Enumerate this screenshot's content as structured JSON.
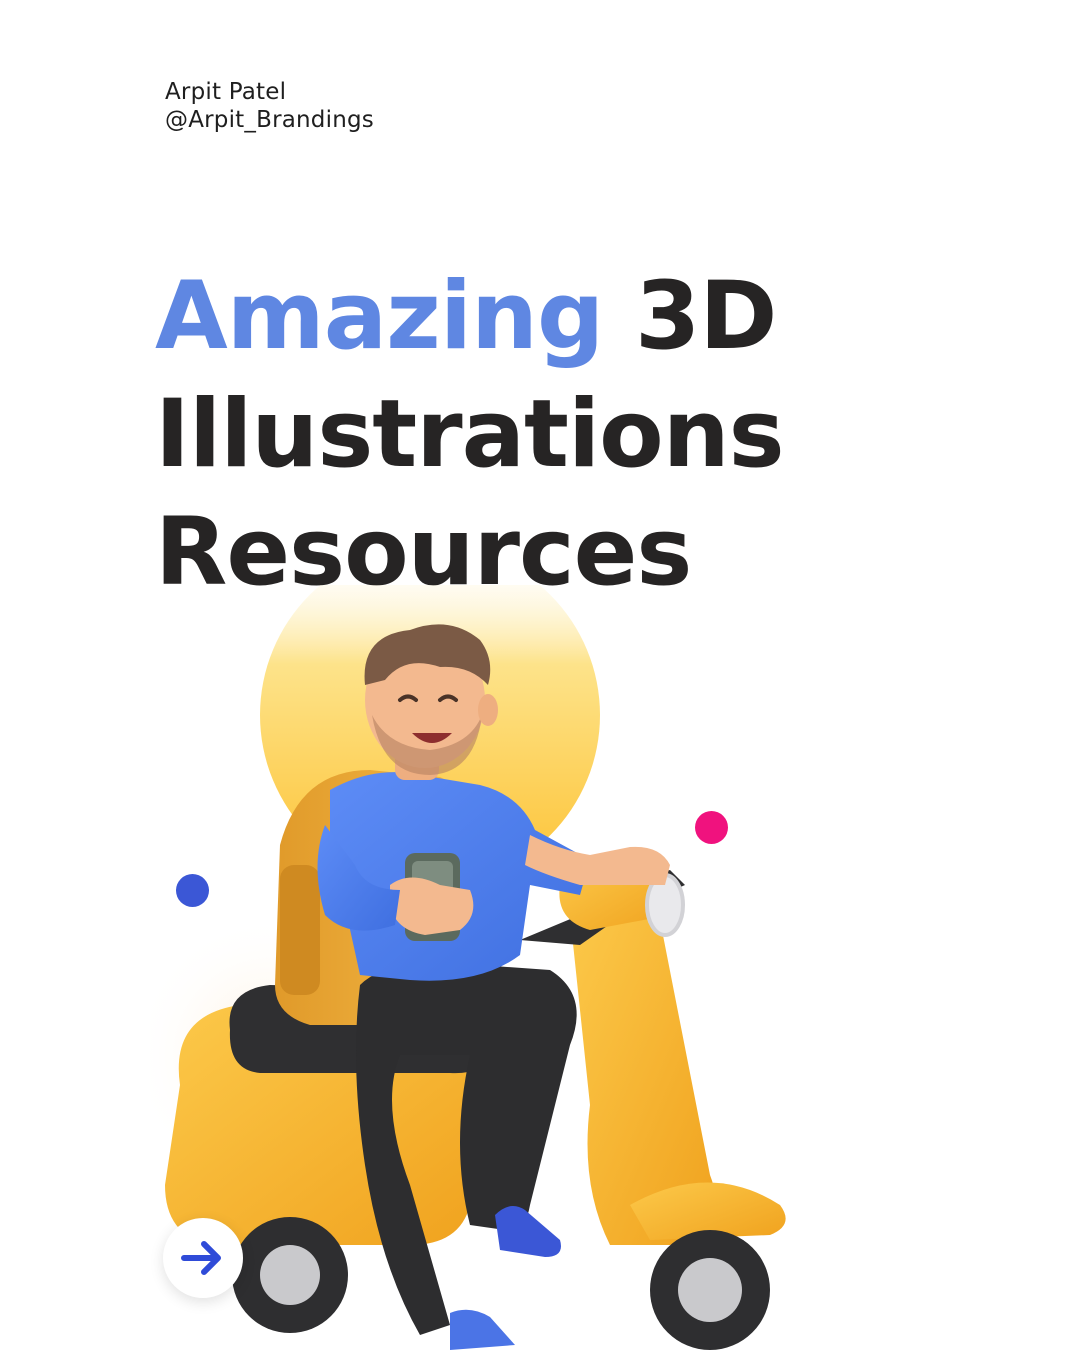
{
  "author": {
    "name": "Arpit Patel",
    "handle": "@Arpit_Brandings"
  },
  "headline": {
    "accent_word": "Amazing",
    "line1_rest": " 3D",
    "line2": "Illustrations",
    "line3": "Resources"
  },
  "colors": {
    "accent": "#5f87e2",
    "text": "#262424",
    "dot_blue": "#3b57d6",
    "dot_pink": "#f0127e",
    "scooter": "#f7b52b",
    "shirt": "#4f7ff0",
    "sun": "#fdd14a"
  },
  "illustration": {
    "subject": "3d-character-on-scooter-illustration"
  },
  "navigation": {
    "next_icon": "arrow-right-icon"
  }
}
